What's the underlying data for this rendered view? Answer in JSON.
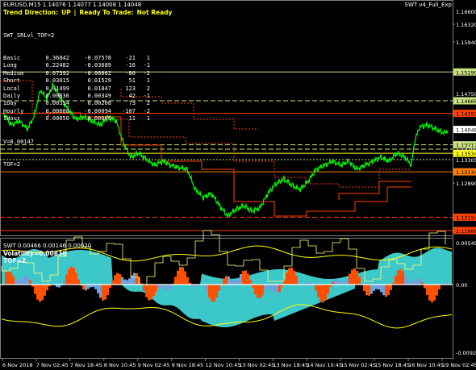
{
  "main_chart": {
    "title": "EURUSD,M15  1.14076 1.14077 1.14008 1.14048",
    "expert_name": "SWT v4_Full_Exp",
    "status": {
      "trend_label": "Trend Direction:",
      "trend_value": "UP",
      "separator": "|",
      "ready_label": "Ready To Trade:",
      "ready_value": "Not Ready"
    },
    "indicator_name": "SWT_SRLvl_TOF=2",
    "table": [
      [
        "Basic",
        "0.36842",
        "-0.07578",
        "-21",
        "1"
      ],
      [
        "Long",
        "0.22482",
        "-0.03689",
        "-16",
        "-1"
      ],
      [
        "Medium",
        "0.07592",
        "-0.06062",
        "-80",
        "-2"
      ],
      [
        "Short",
        "0.03015",
        "0.01529",
        "51",
        "1"
      ],
      [
        "Local",
        "0.01499",
        "0.01847",
        "123",
        "2"
      ],
      [
        "Daily",
        "0.00836",
        "0.00349",
        "42",
        "-1"
      ],
      [
        "IDay",
        "0.00354",
        "0.00208",
        "73",
        "2"
      ],
      [
        "Hourly",
        "0.00088",
        "-0.00094",
        "-107",
        "-2"
      ],
      [
        "IHour",
        "0.00050",
        "0.00006",
        "11",
        "1"
      ]
    ],
    "v_line": "V=0.00147",
    "tof_line": "TOF=2",
    "price_axis": [
      {
        "label": "1.16600",
        "price": 1.166,
        "color": "#000000",
        "bg": ""
      },
      {
        "label": "1.16320",
        "price": 1.1632,
        "color": "#ffffff",
        "bg": ""
      },
      {
        "label": "1.15940",
        "price": 1.1594,
        "color": "#ffffff",
        "bg": ""
      },
      {
        "label": "1.15290",
        "price": 1.1529,
        "color": "#000000",
        "bg": "#c8e080"
      },
      {
        "label": "1.14668",
        "price": 1.14668,
        "color": "#000000",
        "bg": "#c8e080"
      },
      {
        "label": "1.14397",
        "price": 1.14397,
        "color": "#000000",
        "bg": "#ff4000"
      },
      {
        "label": "1.14048",
        "price": 1.14048,
        "color": "#000000",
        "bg": "#ffffff"
      },
      {
        "label": "1.13717",
        "price": 1.13717,
        "color": "#000000",
        "bg": "#c8e080"
      },
      {
        "label": "1.13534",
        "price": 1.13534,
        "color": "#000000",
        "bg": "#ffff00"
      },
      {
        "label": "1.13134",
        "price": 1.13134,
        "color": "#000000",
        "bg": "#ff8000"
      },
      {
        "label": "1.12890",
        "price": 1.1289,
        "color": "#ffffff",
        "bg": ""
      },
      {
        "label": "1.12154",
        "price": 1.12154,
        "color": "#000000",
        "bg": "#ff4000"
      },
      {
        "label": "1.11866",
        "price": 1.11866,
        "color": "#000000",
        "bg": "#ff4000"
      }
    ],
    "extra_axis_labels": [
      "1.14750",
      "1.13700",
      "1.13305"
    ]
  },
  "sub_chart": {
    "title": "SWT 0.00466 0.00146 0.00020",
    "volatility": "Volatility=0.00836",
    "tof": "TOF=2",
    "axis": [
      {
        "label": "0.00549"
      },
      {
        "label": "0.00"
      },
      {
        "label": "-0.00921"
      }
    ]
  },
  "time_axis": [
    "6 Nov 2018",
    "7 Nov 02:45",
    "7 Nov 18:45",
    "8 Nov 10:45",
    "9 Nov 02:45",
    "9 Nov 18:45",
    "12 Nov 10:45",
    "13 Nov 02:45",
    "13 Nov 18:45",
    "14 Nov 10:45",
    "15 Nov 02:45",
    "15 Nov 18:45",
    "16 Nov 10:45",
    "19 Nov 02:45"
  ],
  "colors": {
    "price_line": "#00ff00",
    "resistance": "#ff4000",
    "support_dash": "#c8e080",
    "cyan_fill": "#3cc8c8",
    "orange_fill": "#ff5000",
    "blue_fill": "#6ea0dc",
    "yellow": "#ffff00"
  }
}
